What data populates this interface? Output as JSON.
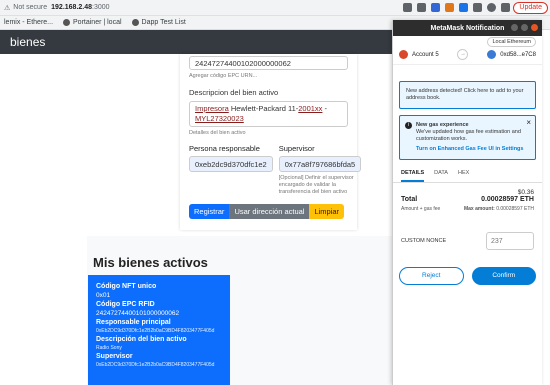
{
  "browser": {
    "security": "Not secure",
    "url_host": "192.168.2.48",
    "url_port": ":3000",
    "update": "Update",
    "bookmarks": [
      {
        "label": "lemix - Ethere..."
      },
      {
        "label": "Portainer | local"
      },
      {
        "label": "Dapp Test List"
      }
    ]
  },
  "app": {
    "header_title": "bienes"
  },
  "form": {
    "epc_value": "24247274400102000000062",
    "epc_hint": "Agregar código EPC URN...",
    "desc_label": "Descripcion del bien activo",
    "desc_word1": "Impresora",
    "desc_rest": " Hewlett-Packard 11-",
    "desc_u2": "2001xx",
    "desc_tail": " -",
    "desc_line2": "MYL27320023",
    "desc_hint": "Detalles del bien activo",
    "resp_label": "Persona responsable",
    "resp_value": "0xeb2dc9d370dfc1e2",
    "sup_label": "Supervisor",
    "sup_value": "0x77a8f797686bfda5",
    "sup_hint": "[Opcional] Definir el supervisor encargado de validar la transferencia del bien activo",
    "btn_register": "Registrar",
    "btn_use_dir": "Usar dirección actual",
    "btn_clear": "Limpiar"
  },
  "assets": {
    "title": "Mis bienes activos",
    "card": {
      "k1": "Código NFT unico",
      "v1": "0x01",
      "k2": "Código EPC RFID",
      "v2": "24247274400101000000062",
      "k3": "Responsable principal",
      "v3": "0xEb2DC9d370Dfc1e2B2b0aC9BD4F8203477F405d",
      "k4": "Descripción del bien activo",
      "v4": "Radio Sony",
      "k5": "Supervisor",
      "v5": "0xEb2DC9d370Dfc1e2B2b0aC9BD4F8203477F405d"
    }
  },
  "metamask": {
    "title": "MetaMask Notification",
    "network": "Local Ethereum",
    "from_account": "Account 5",
    "to_account": "0xd58...e7C8",
    "alert_new_address": "New address detected! Click here to add to your address book.",
    "gas_title": "New gas experience",
    "gas_body": "We've updated how gas fee estimation and customization works.",
    "gas_link": "Turn on Enhanced Gas Fee UI in Settings",
    "tabs": [
      "DETAILS",
      "DATA",
      "HEX"
    ],
    "total_usd": "$0.36",
    "total_label": "Total",
    "total_eth": "0.00028597 ETH",
    "amount_gas_label": "Amount + gas fee",
    "max_amount_label": "Max amount:",
    "max_amount": "0.00028597 ETH",
    "nonce_label": "CUSTOM NONCE",
    "nonce_placeholder": "237",
    "reject": "Reject",
    "confirm": "Confirm"
  }
}
